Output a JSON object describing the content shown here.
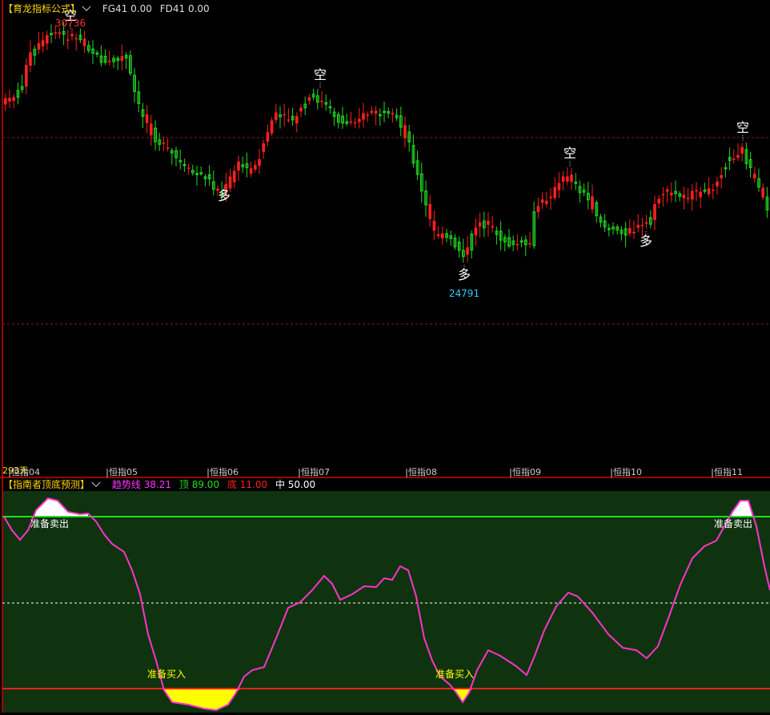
{
  "main": {
    "title": "【育龙指标公式】",
    "params": [
      {
        "label": "FG41",
        "value": "0.00"
      },
      {
        "label": "FD41",
        "value": "0.00"
      }
    ],
    "annotations": [
      {
        "text": "空",
        "color": "#ffffff"
      },
      {
        "text": "空",
        "color": "#ffffff"
      },
      {
        "text": "空",
        "color": "#ffffff"
      },
      {
        "text": "空",
        "color": "#ffffff"
      },
      {
        "text": "多",
        "color": "#ffffff"
      },
      {
        "text": "多",
        "color": "#ffffff"
      },
      {
        "text": "多",
        "color": "#ffffff"
      }
    ],
    "high_label": "30736",
    "low_label": "24791",
    "xaxis_left": "293天",
    "month_labels": [
      "恒指04",
      "恒指05",
      "恒指06",
      "恒指07",
      "恒指08",
      "恒指09",
      "恒指10",
      "恒指11"
    ],
    "colors": {
      "up": "#ff2020",
      "down": "#22dd22",
      "grid": "#8b1a1a",
      "axis": "#d00000",
      "high": "#ff3030",
      "low": "#33ccff"
    }
  },
  "indicator": {
    "title": "【指南者顶底预测】",
    "values": [
      {
        "label": "趋势线",
        "value": "38.21",
        "color": "#ff33ff"
      },
      {
        "label": "顶",
        "value": "89.00",
        "color": "#22dd22"
      },
      {
        "label": "底",
        "value": "11.00",
        "color": "#ff2020"
      },
      {
        "label": "中",
        "value": "50.00",
        "color": "#ffffff"
      }
    ],
    "sell_labels": [
      "准备卖出",
      "准备卖出"
    ],
    "buy_labels": [
      "准备买入",
      "准备买入"
    ],
    "colors": {
      "bg": "#0f330f",
      "trend": "#ff33cc",
      "top": "#22dd22",
      "bottom": "#ff2020",
      "mid": "#ffffff",
      "sell_fill": "#ffffff",
      "buy_fill": "#ffff00"
    }
  }
}
